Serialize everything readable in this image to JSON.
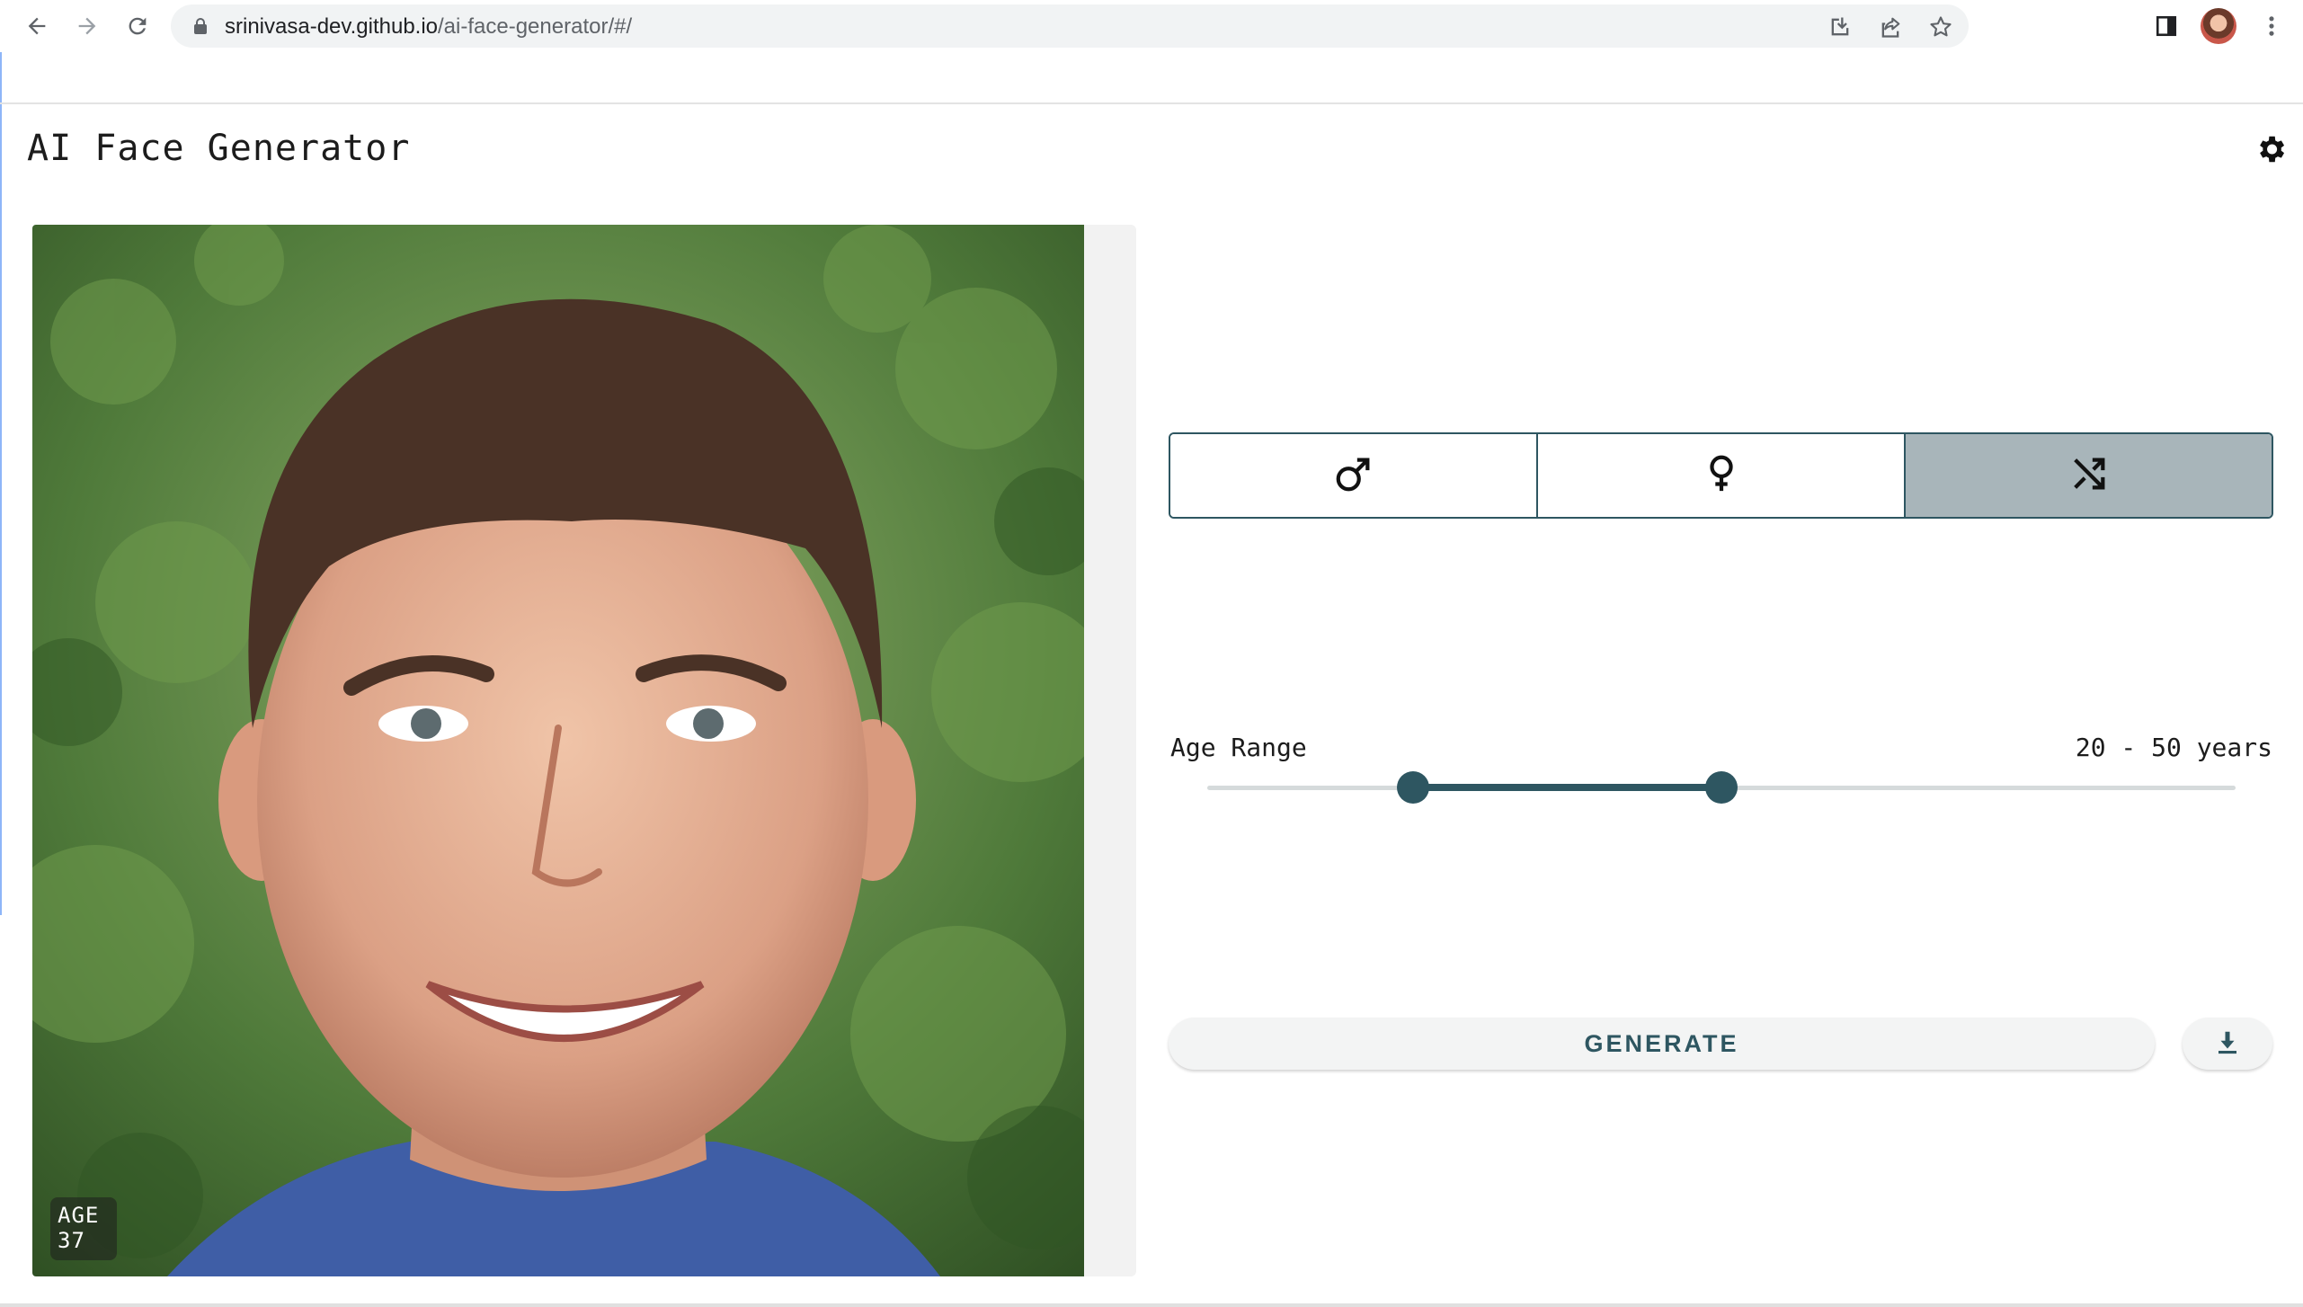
{
  "browser": {
    "url_host": "srinivasa-dev.github.io",
    "url_path": "/ai-face-generator/#/",
    "icons": [
      "back-icon",
      "forward-icon",
      "reload-icon",
      "lock-icon",
      "install-icon",
      "share-icon",
      "star-icon",
      "side-panel-icon",
      "profile-avatar",
      "more-icon"
    ]
  },
  "app": {
    "title": "AI Face Generator",
    "settings_icon": "gear-icon"
  },
  "photo": {
    "age_label": "AGE",
    "age_value": "37"
  },
  "gender": {
    "options": [
      {
        "id": "male",
        "icon": "male-symbol-icon",
        "selected": false
      },
      {
        "id": "female",
        "icon": "female-symbol-icon",
        "selected": false
      },
      {
        "id": "random",
        "icon": "shuffle-icon",
        "selected": true
      }
    ]
  },
  "age_range": {
    "label": "Age Range",
    "value_text": "20 - 50 years",
    "min_fraction": 0.2,
    "max_fraction": 0.5
  },
  "actions": {
    "generate_label": "GENERATE",
    "download_icon": "download-icon"
  },
  "colors": {
    "accent": "#2e5661",
    "selected_bg": "#a8b5ba",
    "rail": "#d5dadb"
  }
}
